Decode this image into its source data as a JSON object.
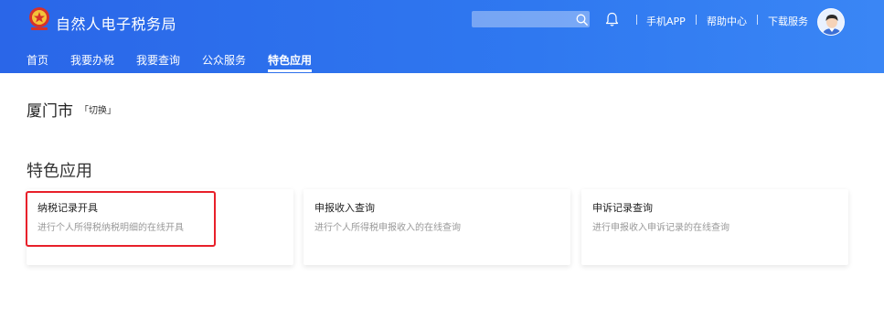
{
  "header": {
    "title": "自然人电子税务局",
    "search_placeholder": "",
    "links": [
      "手机APP",
      "帮助中心",
      "下载服务"
    ]
  },
  "nav": {
    "items": [
      "首页",
      "我要办税",
      "我要查询",
      "公众服务",
      "特色应用"
    ],
    "active_index": 4
  },
  "location": {
    "city": "厦门市",
    "switch_label": "「切换」"
  },
  "section": {
    "title": "特色应用"
  },
  "cards": [
    {
      "title": "纳税记录开具",
      "description": "进行个人所得税纳税明细的在线开具",
      "highlighted": true
    },
    {
      "title": "申报收入查询",
      "description": "进行个人所得税申报收入的在线查询",
      "highlighted": false
    },
    {
      "title": "申诉记录查询",
      "description": "进行申报收入申诉记录的在线查询",
      "highlighted": false
    }
  ],
  "colors": {
    "header_blue": "#2f78f0",
    "highlight_red": "#e8202a"
  },
  "icons": {
    "logo": "tax-emblem-icon",
    "search": "search-icon",
    "bell": "bell-icon",
    "avatar": "user-avatar"
  }
}
